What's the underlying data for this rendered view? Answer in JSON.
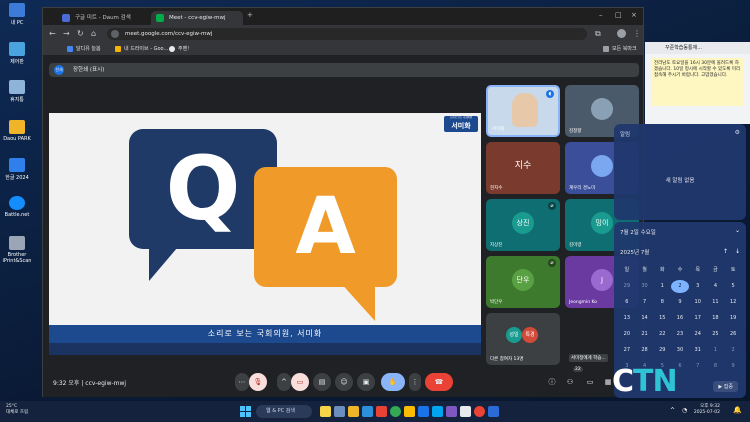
{
  "desktop": {
    "icons": [
      {
        "label": "내 PC"
      },
      {
        "label": "제어판"
      },
      {
        "label": "휴지통"
      },
      {
        "label": "Daou PARK"
      },
      {
        "label": "한글 2024"
      },
      {
        "label": "Battle.net"
      },
      {
        "label": "Brother iPrint&Scan"
      }
    ]
  },
  "browser": {
    "tabs": [
      {
        "label": "구글 미트 - Daum 검색"
      },
      {
        "label": "Meet - ccv-egiw-mwj"
      }
    ],
    "url": "meet.google.com/ccv-egiw-mwj",
    "bookmarks": [
      {
        "label": "달디유 늘봄"
      },
      {
        "label": "내 드라이브 - Goo..."
      },
      {
        "label": "주멘!"
      }
    ],
    "all_bookmarks": "모든 북마크"
  },
  "meet": {
    "presenter": "장한쇄 (표시)",
    "presenter_avatar": "한쇄",
    "slide": {
      "q": "Q",
      "a": "A",
      "caption": "소리로 보는 국회의원, 서미화",
      "logo_small": "소리로 보는 국회의원",
      "logo": "서미화"
    },
    "tiles": [
      {
        "name": "서미화"
      },
      {
        "name": "김정향"
      },
      {
        "name": "현지수",
        "initials": "지수"
      },
      {
        "name": "계우리 경노미"
      },
      {
        "name": "지상진",
        "initials": "상진"
      },
      {
        "name": "김미령",
        "initials": "밍이"
      },
      {
        "name": "박단우",
        "initials": "단우"
      },
      {
        "name": "Jeongmin Ko",
        "initials": "J"
      },
      {
        "name": "다른 참여자 13명",
        "a": "성일",
        "b": "특경"
      },
      {
        "name": "서미정에게 학습..."
      }
    ],
    "time": "9:32 오후",
    "code": "ccv-egiw-mwj",
    "raise_count": "22"
  },
  "sidepanel": {
    "title": "꾸준학습동통재...",
    "note": "전라남도 토요일을 16시 30분에 올려드록 하겠습니다. 10일 정시에 시작할 수 있도록 미리 접속해 주시기 바랍니다. 고맙겠습니다."
  },
  "notifications": {
    "title": "알림",
    "empty": "새 알림 없음"
  },
  "calendar": {
    "date": "7월 2일 수요일",
    "month": "2025년 7월",
    "weekdays": [
      "일",
      "월",
      "화",
      "수",
      "목",
      "금",
      "토"
    ],
    "days": [
      "29",
      "30",
      "1",
      "2",
      "3",
      "4",
      "5",
      "6",
      "7",
      "8",
      "9",
      "10",
      "11",
      "12",
      "13",
      "14",
      "15",
      "16",
      "17",
      "18",
      "19",
      "20",
      "21",
      "22",
      "23",
      "24",
      "25",
      "26",
      "27",
      "28",
      "29",
      "30",
      "31",
      "1",
      "2",
      "3",
      "4",
      "5",
      "6",
      "7",
      "8",
      "9"
    ],
    "focus": "▶ 집중"
  },
  "watermark": {
    "c": "C",
    "tn": "TN"
  },
  "taskbar": {
    "weather_temp": "25°C",
    "weather_desc": "대체로 흐림",
    "search": "웹 & PC 검색",
    "time": "오후 9:32",
    "date": "2025-07-02"
  }
}
